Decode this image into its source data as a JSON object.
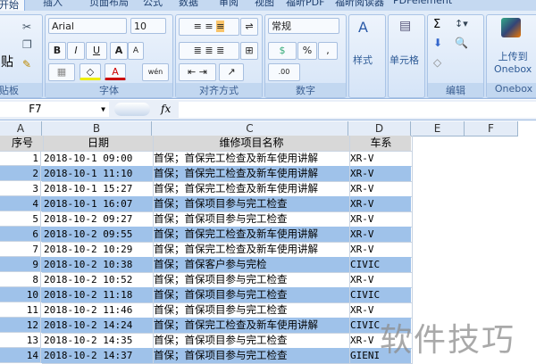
{
  "tabs": [
    "开始",
    "插入",
    "页面布局",
    "公式",
    "数据",
    "审阅",
    "视图",
    "福昕PDF",
    "福昕阅读器",
    "PDFelement"
  ],
  "ribbon": {
    "paste": "贴",
    "clipboard": "贴板",
    "font_name": "Arial",
    "font_size": "10",
    "bold": "B",
    "italic": "I",
    "underline": "U",
    "grow": "A",
    "shrink": "A",
    "font_color": "A",
    "wen": "wén",
    "font_group": "字体",
    "align_group": "对齐方式",
    "number_format": "常规",
    "percent": "%",
    "comma": ",",
    "inc_dec": ".00",
    "number_group": "数字",
    "styles": "样式",
    "cells": "单元格",
    "sigma": "Σ",
    "edit_group": "编辑",
    "upload": "上传到",
    "onebox": "Onebox",
    "onebox_group": "Onebox"
  },
  "formula_bar": {
    "name_box": "F7",
    "fx": "fx",
    "value": ""
  },
  "columns": [
    "A",
    "B",
    "C",
    "D",
    "E",
    "F"
  ],
  "headers": [
    "序号",
    "日期",
    "维修项目名称",
    "车系"
  ],
  "rows": [
    [
      "1",
      "2018-10-1 09:00",
      "首保；首保完工检查及新车使用讲解",
      "XR-V"
    ],
    [
      "2",
      "2018-10-1 11:10",
      "首保；首保完工检查及新车使用讲解",
      "XR-V"
    ],
    [
      "3",
      "2018-10-1 15:27",
      "首保；首保完工检查及新车使用讲解",
      "XR-V"
    ],
    [
      "4",
      "2018-10-1 16:07",
      "首保；首保项目参与完工检查",
      "XR-V"
    ],
    [
      "5",
      "2018-10-2 09:27",
      "首保；首保项目参与完工检查",
      "XR-V"
    ],
    [
      "6",
      "2018-10-2 09:55",
      "首保；首保完工检查及新车使用讲解",
      "XR-V"
    ],
    [
      "7",
      "2018-10-2 10:29",
      "首保；首保完工检查及新车使用讲解",
      "XR-V"
    ],
    [
      "9",
      "2018-10-2 10:38",
      "首保；首保客户参与完检",
      "CIVIC"
    ],
    [
      "8",
      "2018-10-2 10:52",
      "首保；首保项目参与完工检查",
      "XR-V"
    ],
    [
      "10",
      "2018-10-2 11:18",
      "首保；首保项目参与完工检查",
      "CIVIC"
    ],
    [
      "11",
      "2018-10-2 11:46",
      "首保；首保项目参与完工检查",
      "XR-V"
    ],
    [
      "12",
      "2018-10-2 14:24",
      "首保；首保完工检查及新车使用讲解",
      "CIVIC"
    ],
    [
      "13",
      "2018-10-2 14:35",
      "首保；首保项目参与完工检查",
      "XR-V"
    ],
    [
      "14",
      "2018-10-2 14:37",
      "首保；首保项目参与完工检查",
      "GIENI"
    ]
  ],
  "watermark": "软件技巧"
}
